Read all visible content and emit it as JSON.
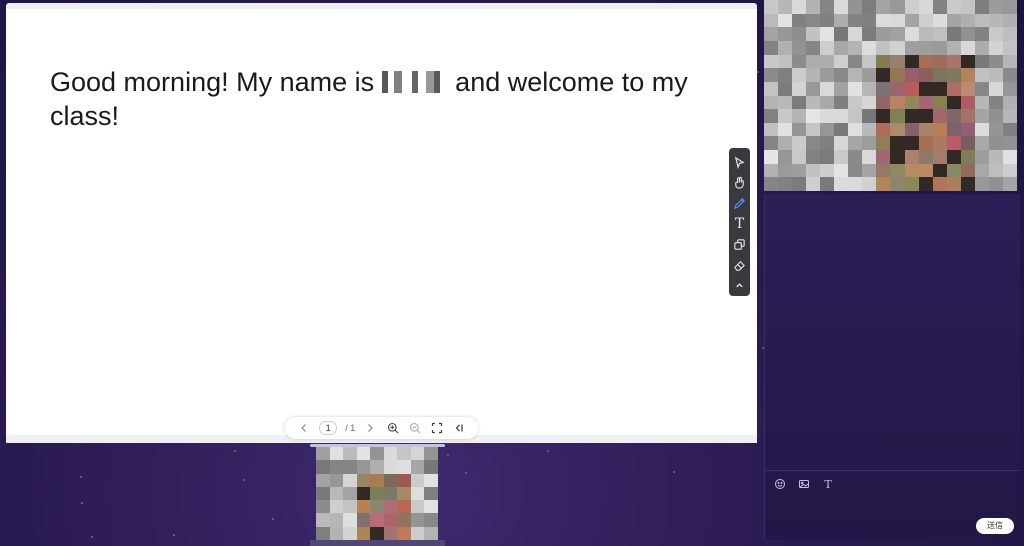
{
  "whiteboard": {
    "text_before": "Good morning! My name is",
    "text_after": "and welcome to my class!"
  },
  "toolbar": {
    "tools": [
      "select-arrow-icon",
      "hand-icon",
      "pen-icon",
      "text-tool-icon",
      "shapes-icon",
      "eraser-icon",
      "collapse-chevron-icon"
    ],
    "active_tool": "pen-icon",
    "text_tool_glyph": "T"
  },
  "pager": {
    "current_page": "1",
    "total_pages": "/ 1"
  },
  "chat": {
    "send_label": "送信",
    "text_tool_glyph": "T"
  },
  "colors": {
    "background": "#2a1a52",
    "active_tool": "#4b8cf0",
    "toolbar_bg": "#3a3a3e"
  }
}
